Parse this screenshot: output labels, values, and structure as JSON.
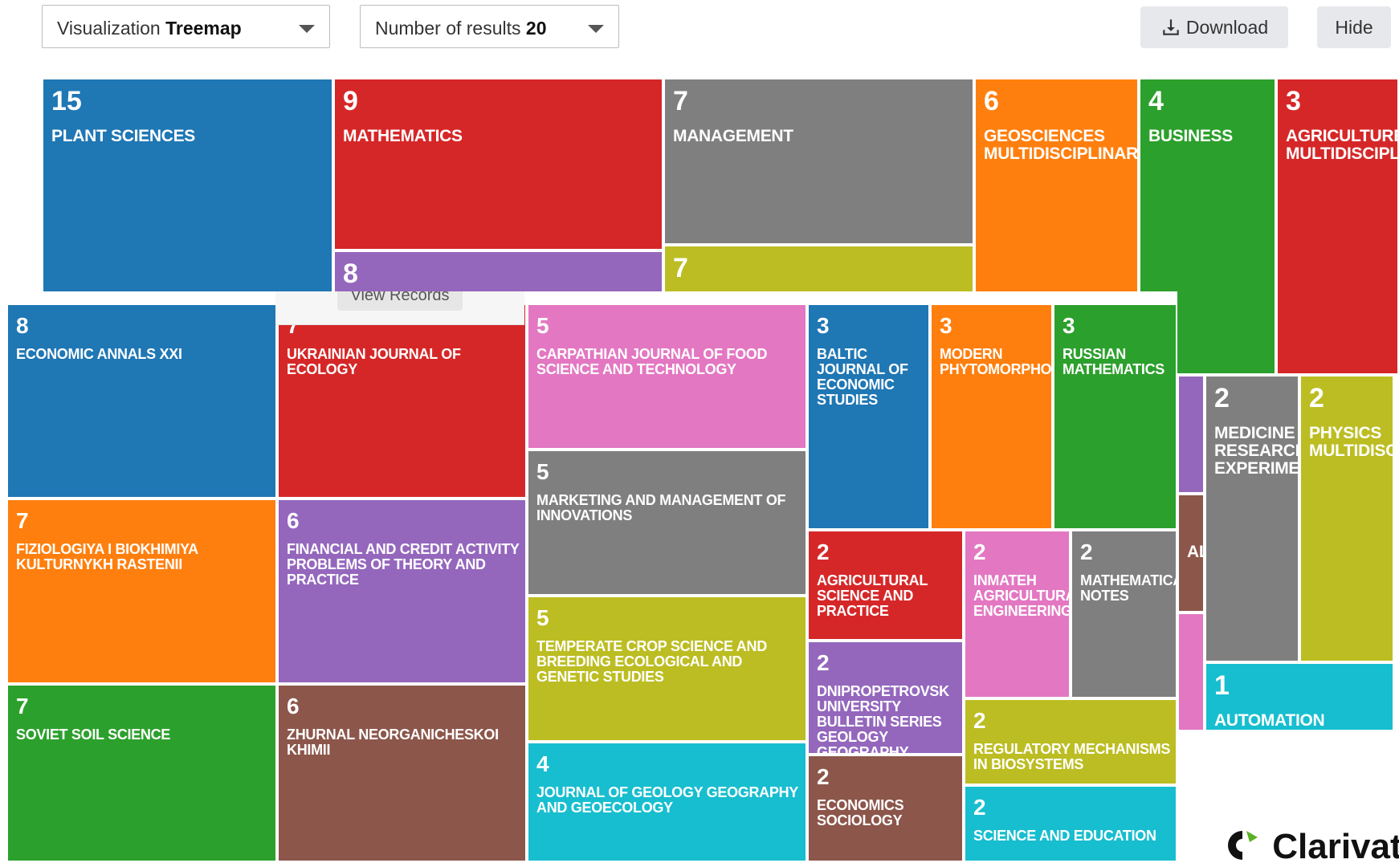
{
  "toolbar": {
    "visualization_label": "Visualization",
    "visualization_value": "Treemap",
    "results_label": "Number of results",
    "results_value": "20",
    "download_label": "Download",
    "hide_label": "Hide"
  },
  "colors": {
    "blue": "#1f77b4",
    "red": "#d62728",
    "gray": "#7f7f7f",
    "orange": "#ff7f0e",
    "green": "#2ca02c",
    "purple": "#9467bd",
    "olive": "#bcbd22",
    "brown": "#8c564b",
    "pink": "#e377c2",
    "cyan": "#17becf"
  },
  "back_tiles": [
    {
      "count": "15",
      "label": "PLANT SCIENCES",
      "color": "blue"
    },
    {
      "count": "9",
      "label": "MATHEMATICS",
      "color": "red"
    },
    {
      "count": "8",
      "label": "",
      "color": "purple"
    },
    {
      "count": "7",
      "label": "MANAGEMENT",
      "color": "gray"
    },
    {
      "count": "7",
      "label": "",
      "color": "olive"
    },
    {
      "count": "6",
      "label": "GEOSCIENCES MULTIDISCIPLINARY",
      "color": "orange"
    },
    {
      "count": "4",
      "label": "BUSINESS",
      "color": "green"
    },
    {
      "count": "3",
      "label": "AGRICULTURE MULTIDISCIPLINARY",
      "color": "red"
    },
    {
      "count": "",
      "label": "",
      "color": "purple"
    },
    {
      "count": "",
      "label": "AL",
      "color": "brown"
    },
    {
      "count": "",
      "label": "",
      "color": "pink"
    },
    {
      "count": "2",
      "label": "MEDICINE RESEARCH EXPERIMENTAL",
      "color": "gray"
    },
    {
      "count": "2",
      "label": "PHYSICS MULTIDISCIPLINARY",
      "color": "olive"
    },
    {
      "count": "1",
      "label": "AUTOMATION",
      "color": "cyan"
    }
  ],
  "front_tiles": [
    {
      "count": "8",
      "label": "ECONOMIC ANNALS XXI",
      "color": "blue"
    },
    {
      "count": "7",
      "label": "FIZIOLOGIYA I BIOKHIMIYA KULTURNYKH RASTENII",
      "color": "orange"
    },
    {
      "count": "7",
      "label": "SOVIET SOIL SCIENCE",
      "color": "green"
    },
    {
      "count": "7",
      "label": "UKRAINIAN JOURNAL OF ECOLOGY",
      "color": "red"
    },
    {
      "count": "6",
      "label": "FINANCIAL AND CREDIT ACTIVITY PROBLEMS OF THEORY AND PRACTICE",
      "color": "purple"
    },
    {
      "count": "6",
      "label": "ZHURNAL NEORGANICHESKOI KHIMII",
      "color": "brown"
    },
    {
      "count": "5",
      "label": "CARPATHIAN JOURNAL OF FOOD SCIENCE AND TECHNOLOGY",
      "color": "pink"
    },
    {
      "count": "5",
      "label": "MARKETING AND MANAGEMENT OF INNOVATIONS",
      "color": "gray"
    },
    {
      "count": "5",
      "label": "TEMPERATE CROP SCIENCE AND BREEDING ECOLOGICAL AND GENETIC STUDIES",
      "color": "olive"
    },
    {
      "count": "4",
      "label": "JOURNAL OF GEOLOGY GEOGRAPHY AND GEOECOLOGY",
      "color": "cyan"
    },
    {
      "count": "3",
      "label": "BALTIC JOURNAL OF ECONOMIC STUDIES",
      "color": "blue"
    },
    {
      "count": "3",
      "label": "MODERN PHYTOMORPHOLOGY",
      "color": "orange"
    },
    {
      "count": "3",
      "label": "RUSSIAN MATHEMATICS",
      "color": "green"
    },
    {
      "count": "2",
      "label": "AGRICULTURAL SCIENCE AND PRACTICE",
      "color": "red"
    },
    {
      "count": "2",
      "label": "DNIPROPETROVSK UNIVERSITY BULLETIN SERIES GEOLOGY GEOGRAPHY",
      "color": "purple"
    },
    {
      "count": "2",
      "label": "ECONOMICS SOCIOLOGY",
      "color": "brown"
    },
    {
      "count": "2",
      "label": "INMATEH AGRICULTURAL ENGINEERING",
      "color": "pink"
    },
    {
      "count": "2",
      "label": "MATHEMATICAL NOTES",
      "color": "gray"
    },
    {
      "count": "2",
      "label": "REGULATORY MECHANISMS IN BIOSYSTEMS",
      "color": "olive"
    },
    {
      "count": "2",
      "label": "SCIENCE AND EDUCATION",
      "color": "cyan"
    }
  ],
  "tooltip": {
    "view_records_label": "View Records"
  },
  "brand": {
    "logo_text": "Clarivate"
  }
}
